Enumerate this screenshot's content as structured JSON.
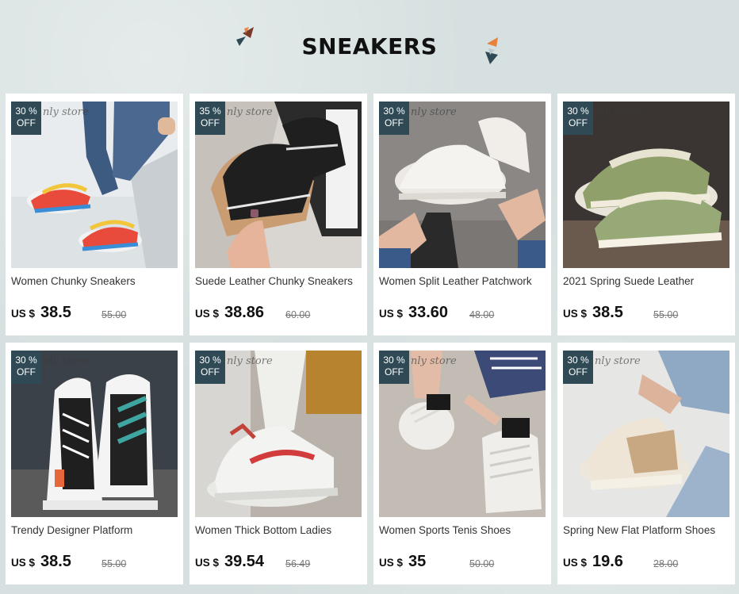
{
  "header": {
    "title": "SNEAKERS"
  },
  "watermark_text": "nly store",
  "products": [
    {
      "discount_pct": "30 %",
      "discount_label": "OFF",
      "name": "Women Chunky Sneakers",
      "currency": "US $",
      "price": "38.5",
      "old_price": "55.00",
      "icon": "sneaker-photo-legs-white-stairs"
    },
    {
      "discount_pct": "35 %",
      "discount_label": "OFF",
      "name": "Suede Leather Chunky Sneakers",
      "currency": "US $",
      "price": "38.86",
      "old_price": "60.00",
      "icon": "sneaker-photo-black-tan"
    },
    {
      "discount_pct": "30 %",
      "discount_label": "OFF",
      "name": "Women Split Leather Patchwork",
      "currency": "US $",
      "price": "33.60",
      "old_price": "48.00",
      "icon": "sneaker-photo-white-chunky"
    },
    {
      "discount_pct": "30 %",
      "discount_label": "OFF",
      "name": "2021 Spring Suede Leather",
      "currency": "US $",
      "price": "38.5",
      "old_price": "55.00",
      "icon": "sneaker-photo-olive-green"
    },
    {
      "discount_pct": "30 %",
      "discount_label": "OFF",
      "name": "Trendy Designer Platform",
      "currency": "US $",
      "price": "38.5",
      "old_price": "55.00",
      "icon": "sneaker-photo-black-white-teal"
    },
    {
      "discount_pct": "30 %",
      "discount_label": "OFF",
      "name": "Women Thick Bottom Ladies",
      "currency": "US $",
      "price": "39.54",
      "old_price": "56.49",
      "icon": "sneaker-photo-white-red"
    },
    {
      "discount_pct": "30 %",
      "discount_label": "OFF",
      "name": "Women Sports Tenis Shoes",
      "currency": "US $",
      "price": "35",
      "old_price": "50.00",
      "icon": "sneaker-photo-white-lacing"
    },
    {
      "discount_pct": "30 %",
      "discount_label": "OFF",
      "name": "Spring New Flat Platform Shoes",
      "currency": "US $",
      "price": "19.6",
      "old_price": "28.00",
      "icon": "sneaker-photo-cream-beige"
    }
  ],
  "colors": {
    "badge": "#2f4a55",
    "page_bg": "#d7e0e0",
    "deco_brown": "#7a3a2a",
    "deco_orange": "#e8823a",
    "deco_teal": "#2f4a55"
  }
}
